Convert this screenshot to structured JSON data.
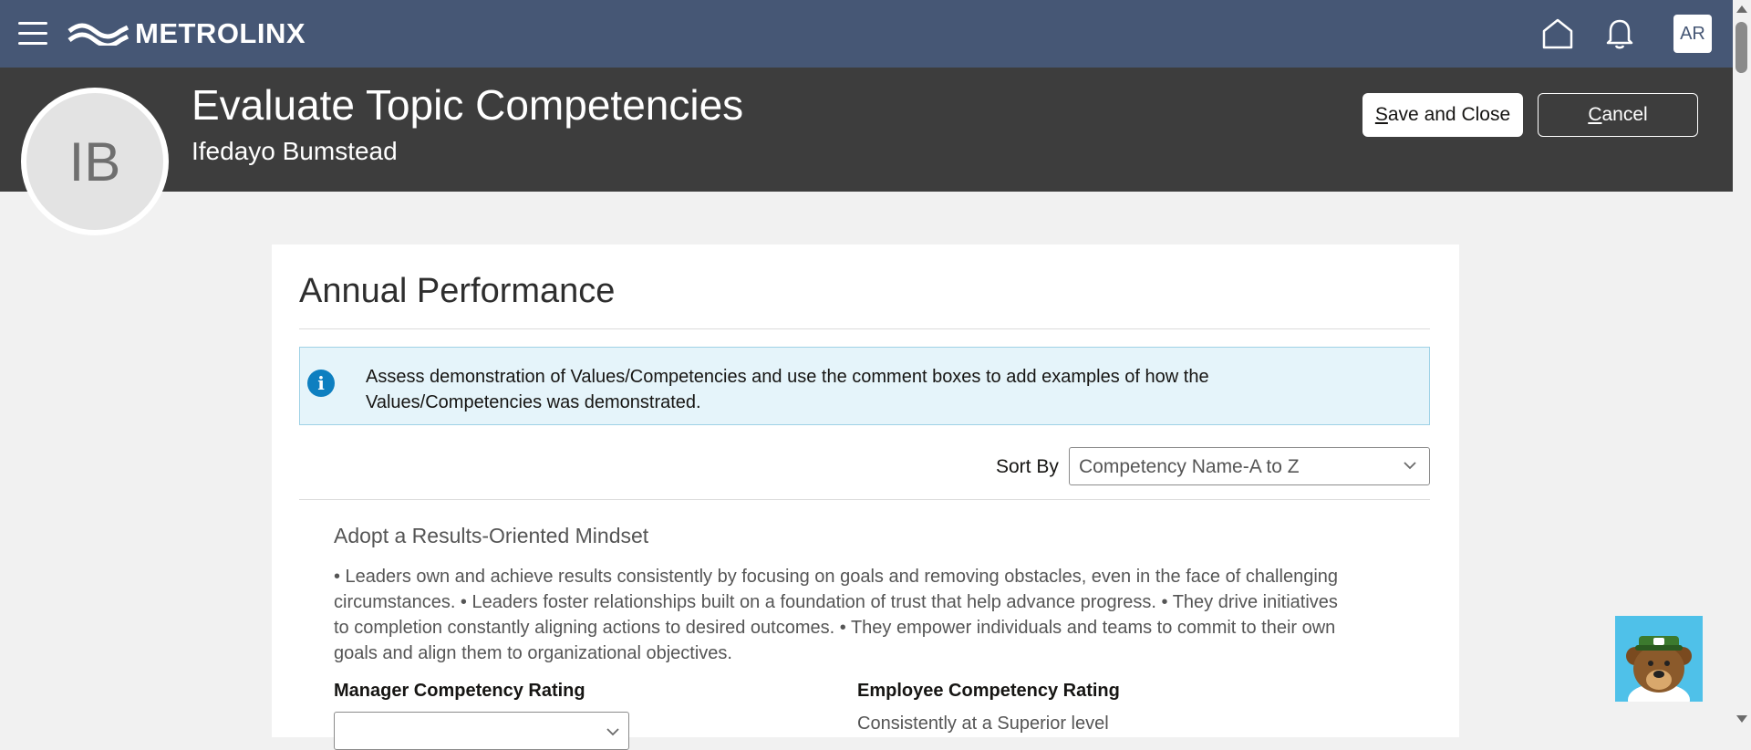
{
  "topbar": {
    "brand": "METROLINX",
    "user_initials": "AR",
    "menu_icon": "hamburger-menu-icon",
    "home_icon": "home-icon",
    "bell_icon": "bell-icon"
  },
  "header": {
    "avatar_initials": "IB",
    "title": "Evaluate Topic Competencies",
    "subtitle": "Ifedayo Bumstead",
    "save_close": {
      "accesskey": "S",
      "rest": "ave and Close"
    },
    "cancel": {
      "accesskey": "C",
      "rest": "ancel"
    }
  },
  "main": {
    "section_title": "Annual Performance",
    "info_message": "Assess demonstration of Values/Competencies and use the comment boxes to add examples of how the Values/Competencies was demonstrated.",
    "sort_by_label": "Sort By",
    "sort_by_value": "Competency Name-A to Z",
    "competency": {
      "name": "Adopt a Results-Oriented Mindset",
      "description": "• Leaders own and achieve results consistently by focusing on goals and removing obstacles, even in the face of challenging circumstances. • Leaders foster relationships built on a foundation of trust that help advance progress. • They drive initiatives to completion constantly aligning actions to desired outcomes. • They empower individuals and teams to commit to their own goals and align them to organizational objectives.",
      "manager_rating_label": "Manager Competency Rating",
      "manager_rating_value": "",
      "employee_rating_label": "Employee Competency Rating",
      "employee_rating_value": "Consistently at a Superior level"
    }
  },
  "colors": {
    "topbar": "#465775",
    "header": "#3d3d3d",
    "info_bg": "#e5f4fa",
    "info_icon": "#0e7fc0"
  }
}
